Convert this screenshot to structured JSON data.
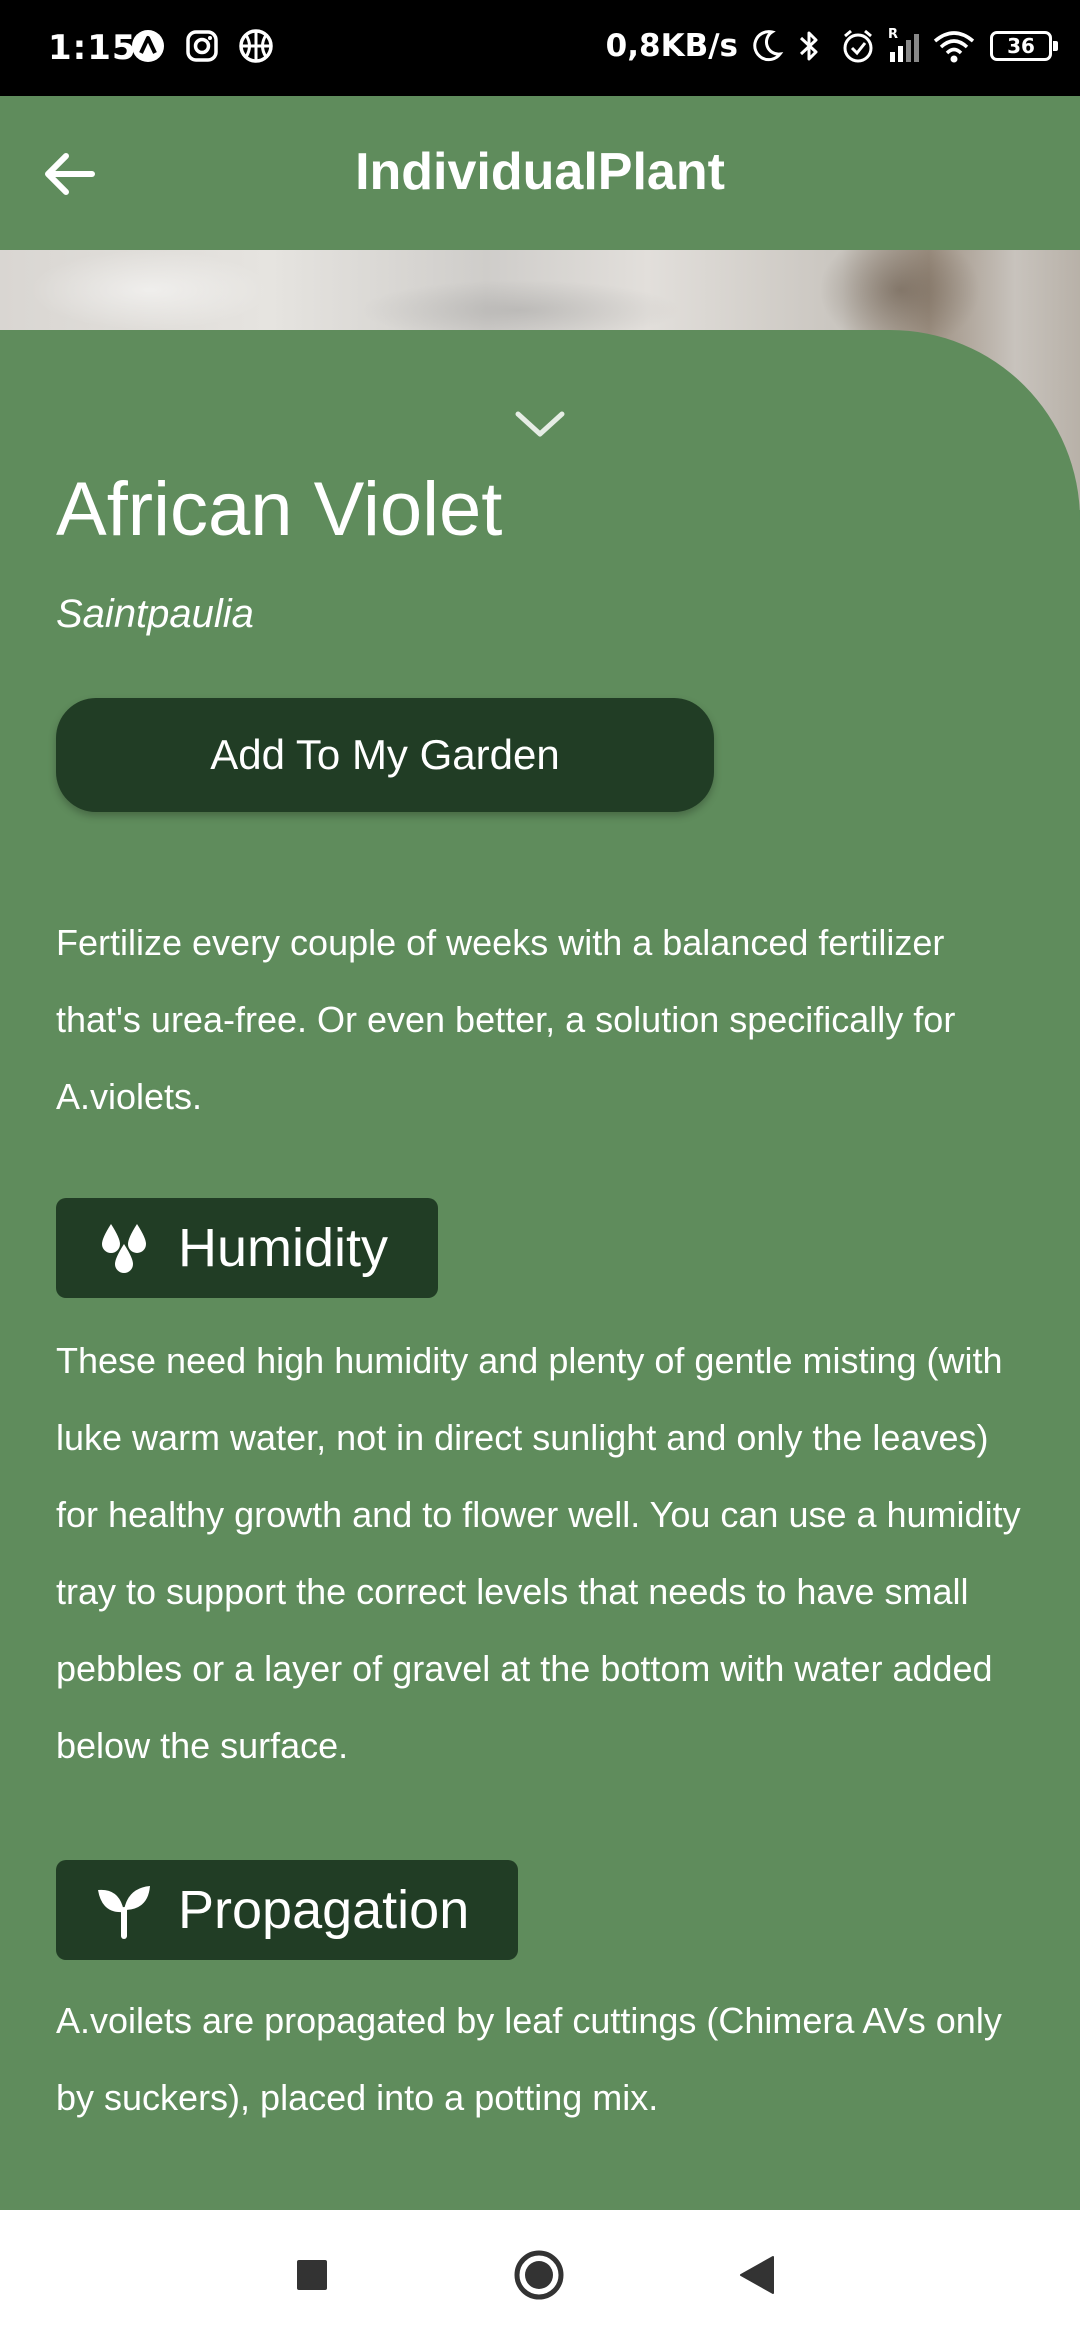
{
  "status_bar": {
    "time": "1:15",
    "left_icons": [
      "app-a-icon",
      "instagram-icon",
      "basketball-icon"
    ],
    "network_speed": "0,8KB/s",
    "right_icons": [
      "moon-icon",
      "bluetooth-icon",
      "alarm-icon",
      "signal-icon",
      "wifi-icon"
    ],
    "signal_badge": "R",
    "battery": "36"
  },
  "app_bar": {
    "title": "IndividualPlant",
    "back_icon": "arrow-back-icon"
  },
  "plant": {
    "name": "African Violet",
    "scientific_name": "Saintpaulia",
    "add_button_label": "Add To My Garden",
    "fertilizer_text": "Fertilize every couple of weeks with a balanced fertilizer that's urea-free. Or even better, a solution specifically for A.violets."
  },
  "sections": {
    "humidity": {
      "title": "Humidity",
      "icon": "water-drops-icon",
      "text": "These need high humidity and plenty of gentle misting (with luke warm water, not in direct sunlight and only the leaves) for healthy growth and to flower well. You can use a humidity tray to support the correct levels that needs to have small pebbles or a layer of gravel at the bottom with water added below the surface."
    },
    "propagation": {
      "title": "Propagation",
      "icon": "sprout-icon",
      "text": "A.voilets are propagated by leaf cuttings (Chimera AVs only by suckers), placed into a potting mix."
    }
  },
  "colors": {
    "primary": "#5f8c5c",
    "dark_accent": "#213d25",
    "text": "#ffffff"
  },
  "nav_bar": {
    "icons": [
      "recents-square-icon",
      "home-circle-icon",
      "back-triangle-icon"
    ]
  }
}
